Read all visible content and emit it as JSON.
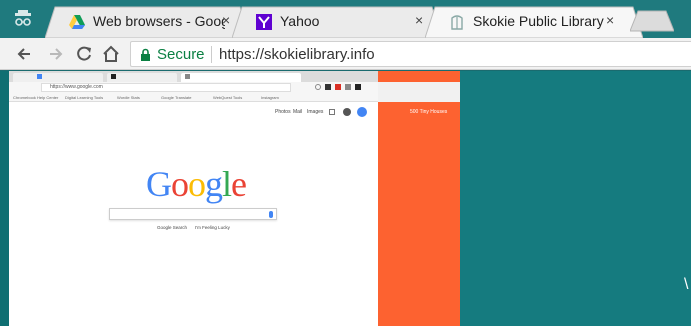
{
  "tabs": [
    {
      "title": "",
      "icon": "incognito-icon"
    },
    {
      "title": "Web browsers - Google",
      "icon": "google-drive-icon",
      "close": "×"
    },
    {
      "title": "Yahoo",
      "icon": "yahoo-icon",
      "close": "×"
    },
    {
      "title": "Skokie Public Library",
      "icon": "skokie-library-icon",
      "close": "×"
    }
  ],
  "toolbar": {
    "back_icon": "back-arrow-icon",
    "forward_icon": "forward-arrow-icon",
    "reload_icon": "reload-icon",
    "home_icon": "home-icon",
    "security": "Secure",
    "url": "https://skokielibrary.info"
  },
  "inner_screenshot": {
    "url": "https://www.google.com",
    "logo": "Google",
    "top_links": [
      "Photos",
      "Mail",
      "Images"
    ],
    "buttons": [
      "Google Search",
      "I'm Feeling Lucky"
    ],
    "bookmarks": [
      "Chromebook Help Center",
      "Digital Learning Tools",
      "Wordle Stats",
      "Google Translate",
      "WebQuest Tools",
      "Instagram"
    ]
  },
  "orange_panel": {
    "label": "500 Tiny Houses"
  },
  "right_glyph": "\\"
}
